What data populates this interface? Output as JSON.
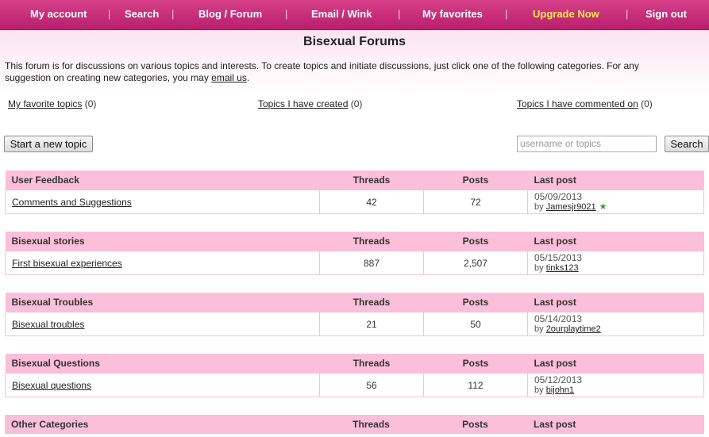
{
  "nav": {
    "items": [
      "My account",
      "Search",
      "Blog / Forum",
      "Email / Wink",
      "My favorites",
      "Upgrade Now",
      "Sign out"
    ],
    "separator": "|"
  },
  "page": {
    "title": "Bisexual Forums",
    "intro": "This forum is for discussions on various topics and interests. To create topics and initiate discussions, just click one of the following categories. For any suggestion on creating new categories, you may",
    "intro_link": "email us",
    "intro_end": "."
  },
  "quick_links": [
    {
      "label": "My favorite topics",
      "count": "(0)"
    },
    {
      "label": "Topics I have created",
      "count": "(0)"
    },
    {
      "label": "Topics I have commented on",
      "count": "(0)"
    }
  ],
  "actions": {
    "new_topic": "Start a new topic",
    "search_placeholder": "username or topics",
    "search_button": "Search"
  },
  "columns": {
    "threads": "Threads",
    "posts": "Posts",
    "last_post": "Last post"
  },
  "categories": [
    {
      "name": "User Feedback",
      "topic": "Comments and Suggestions",
      "threads": "42",
      "posts": "72",
      "date": "05/09/2013",
      "by": "by",
      "user": "Jamesjr9021",
      "star": true
    },
    {
      "name": "Bisexual stories",
      "topic": "First bisexual experiences",
      "threads": "887",
      "posts": "2,507",
      "date": "05/15/2013",
      "by": "by",
      "user": "tinks123"
    },
    {
      "name": "Bisexual Troubles",
      "topic": "Bisexual troubles",
      "threads": "21",
      "posts": "50",
      "date": "05/14/2013",
      "by": "by",
      "user": "2ourplaytime2"
    },
    {
      "name": "Bisexual Questions",
      "topic": "Bisexual questions",
      "threads": "56",
      "posts": "112",
      "date": "05/12/2013",
      "by": "by",
      "user": "bijohn1"
    },
    {
      "name": "Other Categories"
    }
  ],
  "colors": {
    "nav_bg": "#c52a78",
    "header_row": "#fbbfd9",
    "upgrade": "#ffe94a"
  },
  "icons": {
    "online": "star-icon"
  }
}
